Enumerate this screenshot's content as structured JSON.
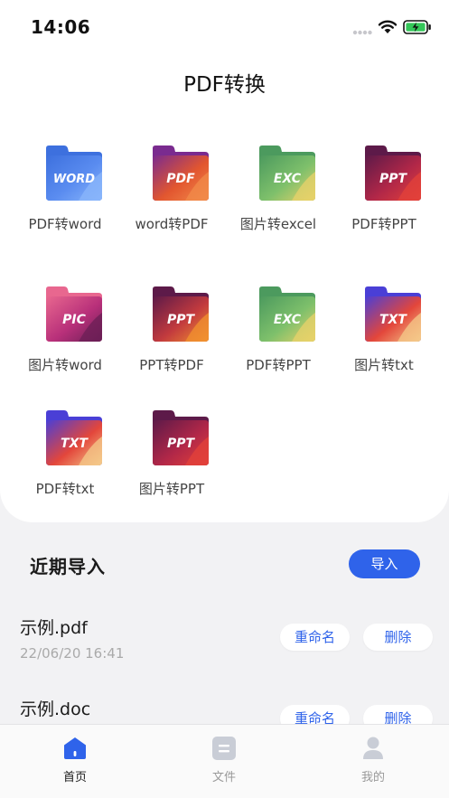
{
  "status_bar": {
    "time": "14:06"
  },
  "header": {
    "title": "PDF转换"
  },
  "tools": [
    {
      "label": "PDF转word",
      "badge": "WORD",
      "icon": "word-file-icon",
      "colors": [
        "#3d70de",
        "#5a8cf0",
        "#89b6fb"
      ]
    },
    {
      "label": "word转PDF",
      "badge": "PDF",
      "icon": "pdf-file-icon",
      "colors": [
        "#7a2b8f",
        "#e2562f",
        "#f28b4a"
      ]
    },
    {
      "label": "图片转excel",
      "badge": "EXC",
      "icon": "excel-file-icon",
      "colors": [
        "#4c9a5e",
        "#7ec06b",
        "#e8d16a"
      ]
    },
    {
      "label": "PDF转PPT",
      "badge": "PPT",
      "icon": "ppt-file-icon",
      "colors": [
        "#5d1a49",
        "#b12748",
        "#e3413a"
      ]
    },
    {
      "label": "图片转word",
      "badge": "PIC",
      "icon": "pic-file-icon",
      "colors": [
        "#e8678f",
        "#b8307a",
        "#6b1f56"
      ]
    },
    {
      "label": "PPT转PDF",
      "badge": "PPT",
      "icon": "ppt-file-icon",
      "colors": [
        "#5d1a49",
        "#c23a3e",
        "#f1922f"
      ]
    },
    {
      "label": "PDF转PPT",
      "badge": "EXC",
      "icon": "excel-file-icon",
      "colors": [
        "#4c9a5e",
        "#7ec06b",
        "#e8d16a"
      ]
    },
    {
      "label": "图片转txt",
      "badge": "TXT",
      "icon": "txt-file-icon",
      "colors": [
        "#4a3fd6",
        "#e3463b",
        "#f4c98a"
      ]
    },
    {
      "label": "PDF转txt",
      "badge": "TXT",
      "icon": "txt-file-icon",
      "colors": [
        "#4a3fd6",
        "#e3463b",
        "#f4c98a"
      ]
    },
    {
      "label": "图片转PPT",
      "badge": "PPT",
      "icon": "ppt-file-icon",
      "colors": [
        "#5d1a49",
        "#b12748",
        "#e3413a"
      ]
    }
  ],
  "recent": {
    "title": "近期导入",
    "import_label": "导入",
    "files": [
      {
        "name": "示例.pdf",
        "time": "22/06/20 16:41",
        "rename_label": "重命名",
        "delete_label": "删除"
      },
      {
        "name": "示例.doc",
        "time": "",
        "rename_label": "重命名",
        "delete_label": "删除"
      }
    ]
  },
  "tabbar": {
    "items": [
      {
        "label": "首页",
        "icon": "home-icon",
        "active": true
      },
      {
        "label": "文件",
        "icon": "file-icon",
        "active": false
      },
      {
        "label": "我的",
        "icon": "profile-icon",
        "active": false
      }
    ]
  },
  "colors": {
    "accent": "#2f63ea",
    "background": "#f2f2f4"
  }
}
